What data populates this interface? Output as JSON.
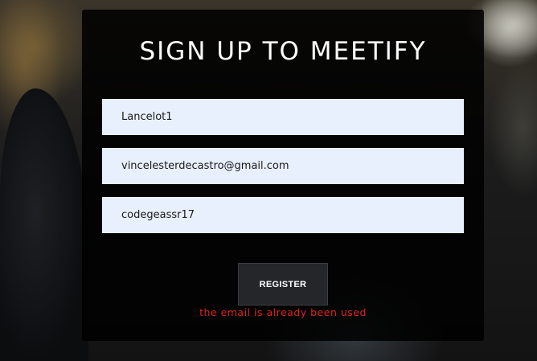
{
  "page": {
    "title": "SIGN UP TO MEETIFY"
  },
  "form": {
    "username_value": "Lancelot1",
    "email_value": "vincelesterdecastro@gmail.com",
    "password_value": "codegeassr17",
    "register_label": "REGISTER",
    "error_message": "the email is already been used"
  },
  "colors": {
    "input_background": "#e8f0fe",
    "error": "#e0241b",
    "button_background": "#24262a"
  }
}
